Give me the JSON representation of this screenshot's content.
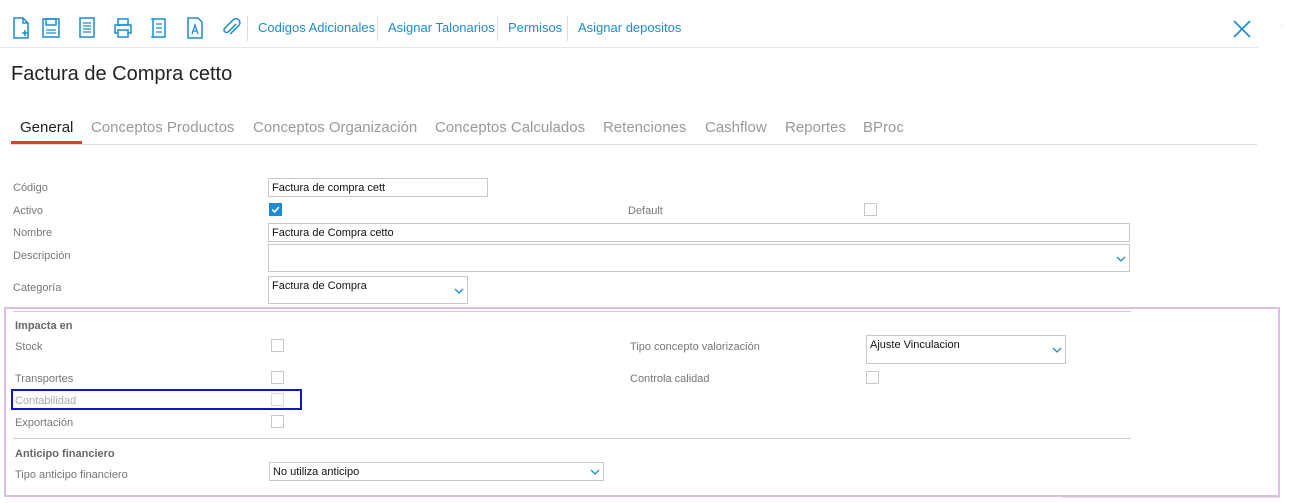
{
  "toolbar": {
    "icons": [
      "new-document-icon",
      "save-icon",
      "list-document-icon",
      "print-icon",
      "report-icon",
      "text-document-icon",
      "attachment-icon"
    ],
    "links": [
      "Codigos Adicionales",
      "Asignar Talonarios",
      "Permisos",
      "Asignar depositos"
    ],
    "close_icon": "close-icon"
  },
  "page": {
    "title": "Factura de Compra cetto"
  },
  "tabs": [
    "General",
    "Conceptos Productos",
    "Conceptos Organización",
    "Conceptos Calculados",
    "Retenciones",
    "Cashflow",
    "Reportes",
    "BProc"
  ],
  "active_tab": "General",
  "form": {
    "codigo": {
      "label": "Código",
      "value": "Factura de compra cett"
    },
    "activo": {
      "label": "Activo",
      "checked": true
    },
    "default": {
      "label": "Default",
      "checked": false
    },
    "nombre": {
      "label": "Nombre",
      "value": "Factura de Compra cetto"
    },
    "descripcion": {
      "label": "Descripción",
      "value": ""
    },
    "categoria": {
      "label": "Categoría",
      "value": "Factura de Compra"
    }
  },
  "impacta": {
    "section_title": "Impacta en",
    "stock": {
      "label": "Stock",
      "checked": false
    },
    "transportes": {
      "label": "Transportes",
      "checked": false
    },
    "contabilidad": {
      "label": "Contabilidad",
      "checked": false
    },
    "exportacion": {
      "label": "Exportación",
      "checked": false
    },
    "tipo_concepto": {
      "label": "Tipo concepto valorización",
      "value": "Ajuste Vinculacion"
    },
    "controla_calidad": {
      "label": "Controla calidad",
      "checked": false
    }
  },
  "anticipo": {
    "section_title": "Anticipo financiero",
    "tipo": {
      "label": "Tipo anticipo financiero",
      "value": "No utiliza anticipo"
    }
  },
  "colors": {
    "accent": "#1b8ccf",
    "tab_underline": "#e0402a",
    "focus_outline": "#1515c8",
    "panel_border": "#dcbfe8"
  }
}
